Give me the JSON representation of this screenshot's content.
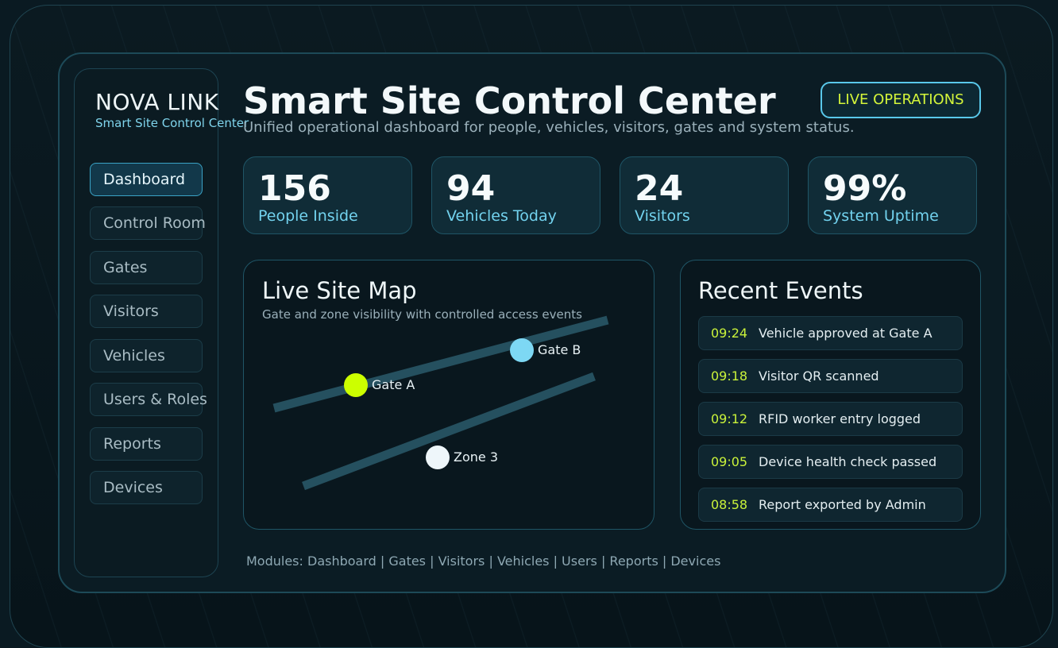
{
  "brand": {
    "name": "NOVA LINK",
    "subtitle": "Smart Site Control Center"
  },
  "sidebar": {
    "items": [
      {
        "label": "Dashboard",
        "active": true
      },
      {
        "label": "Control Room",
        "active": false
      },
      {
        "label": "Gates",
        "active": false
      },
      {
        "label": "Visitors",
        "active": false
      },
      {
        "label": "Vehicles",
        "active": false
      },
      {
        "label": "Users & Roles",
        "active": false
      },
      {
        "label": "Reports",
        "active": false
      },
      {
        "label": "Devices",
        "active": false
      }
    ]
  },
  "header": {
    "title": "Smart Site Control Center",
    "subtitle": "Unified operational dashboard for people, vehicles, visitors, gates and system status.",
    "badge": "LIVE OPERATIONS"
  },
  "stats": [
    {
      "value": "156",
      "label": "People Inside"
    },
    {
      "value": "94",
      "label": "Vehicles Today"
    },
    {
      "value": "24",
      "label": "Visitors"
    },
    {
      "value": "99%",
      "label": "System Uptime"
    }
  ],
  "map": {
    "title": "Live Site Map",
    "subtitle": "Gate and zone visibility with controlled access events",
    "markers": [
      {
        "label": "Gate A",
        "color": "#ccff00"
      },
      {
        "label": "Gate B",
        "color": "#7dd8f4"
      },
      {
        "label": "Zone 3",
        "color": "#eef6fa"
      }
    ]
  },
  "events": {
    "title": "Recent Events",
    "items": [
      {
        "time": "09:24",
        "text": "Vehicle approved at Gate A"
      },
      {
        "time": "09:18",
        "text": "Visitor QR scanned"
      },
      {
        "time": "09:12",
        "text": "RFID worker entry logged"
      },
      {
        "time": "09:05",
        "text": "Device health check passed"
      },
      {
        "time": "08:58",
        "text": "Report exported by Admin"
      }
    ]
  },
  "footer": {
    "modules": "Modules: Dashboard | Gates | Visitors | Vehicles | Users | Reports | Devices"
  },
  "colors": {
    "accent": "#59c8ea",
    "highlight": "#ccff00",
    "background": "#0a1a22"
  }
}
